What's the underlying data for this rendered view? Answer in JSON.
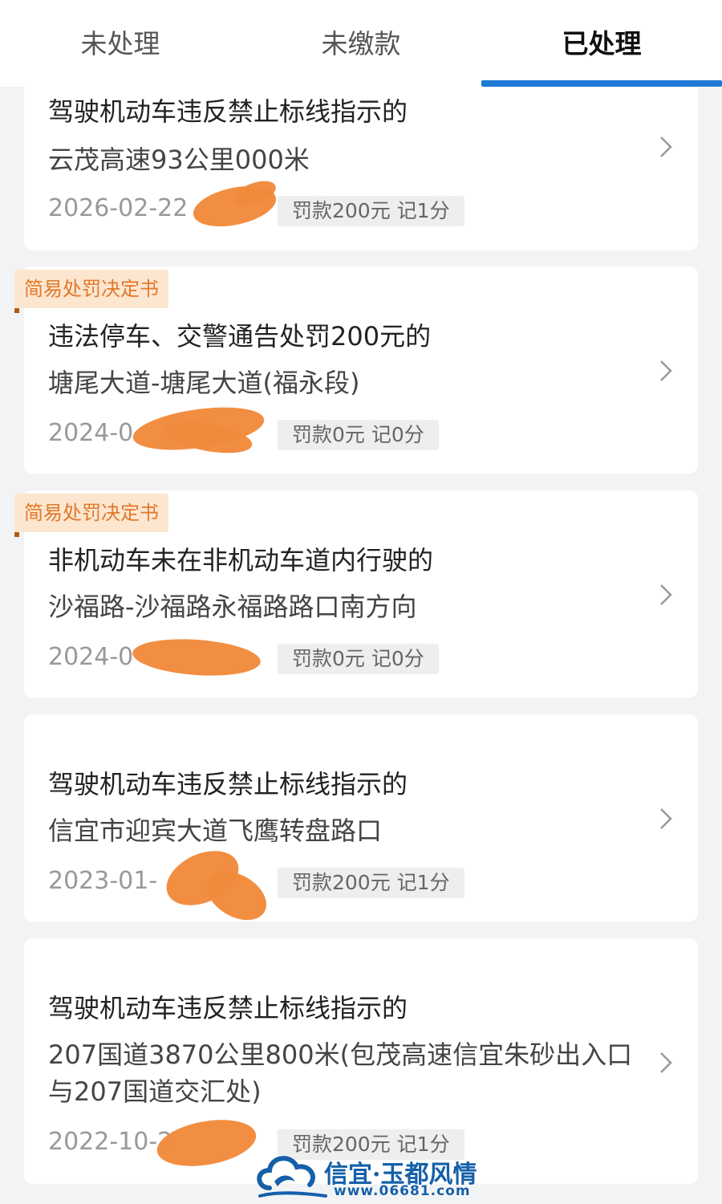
{
  "tabs": [
    {
      "label": "未处理",
      "active": false
    },
    {
      "label": "未缴款",
      "active": false
    },
    {
      "label": "已处理",
      "active": true
    }
  ],
  "accent_color": "#1f7ad6",
  "records": [
    {
      "badge": "",
      "title": "驾驶机动车违反禁止标线指示的",
      "location": "云茂高速93公里000米",
      "date": "2026-02-22",
      "penalty": "罚款200元  记1分",
      "icon": "chevron-right-icon"
    },
    {
      "badge": "简易处罚决定书",
      "title": "违法停车、交警通告处罚200元的",
      "location": "塘尾大道-塘尾大道(福永段)",
      "date": "2024-0",
      "penalty": "罚款0元  记0分",
      "icon": "chevron-right-icon"
    },
    {
      "badge": "简易处罚决定书",
      "title": "非机动车未在非机动车道内行驶的",
      "location": "沙福路-沙福路永福路路口南方向",
      "date": "2024-0",
      "penalty": "罚款0元  记0分",
      "icon": "chevron-right-icon"
    },
    {
      "badge": "",
      "title": "驾驶机动车违反禁止标线指示的",
      "location": "信宜市迎宾大道飞鹰转盘路口",
      "date": "2023-01-",
      "penalty": "罚款200元  记1分",
      "icon": "chevron-right-icon"
    },
    {
      "badge": "",
      "title": "驾驶机动车违反禁止标线指示的",
      "location": "207国道3870公里800米(包茂高速信宜朱砂出入口与207国道交汇处)",
      "date": "2022-10-2",
      "penalty": "罚款200元  记1分",
      "icon": "chevron-right-icon"
    }
  ],
  "watermark": {
    "name": "信宜·玉都风情",
    "url": "www.06681.com"
  }
}
